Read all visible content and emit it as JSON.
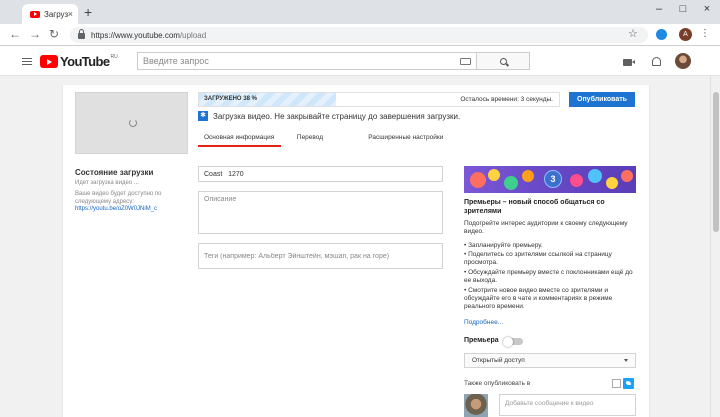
{
  "browser": {
    "tab_title": "Загрузка",
    "tab_close": "×",
    "new_tab": "+",
    "url_host": "https://www.youtube.com",
    "url_path": "/upload",
    "profile_letter": "A",
    "win_min": "–",
    "win_max": "□",
    "win_close": "×",
    "back": "←",
    "forward": "→",
    "reload": "↻",
    "star": "☆",
    "menu": "⋮"
  },
  "header": {
    "logo_text": "YouTube",
    "logo_region": "RU",
    "search_placeholder": "Введите запрос"
  },
  "upload": {
    "status_title": "Состояние загрузки",
    "status_sub": "Идет загрузка видео ...",
    "status_note": "Ваше видео будет доступно по следующему адресу:",
    "status_link": "https://youtu.be/oZ0W0JNiM_c",
    "progress_label": "ЗАГРУЖЕНО 38 %",
    "progress_fraction": 0.38,
    "progress_time": "Осталось времени: 3 секунды.",
    "publish_label": "Опубликовать",
    "notice_icon": "✱",
    "notice_text": "Загрузка видео. Не закрывайте страницу до завершения загрузки."
  },
  "tabs": [
    {
      "label": "Основная информация",
      "active": true
    },
    {
      "label": "Перевод",
      "active": false
    },
    {
      "label": "Расширенные настройки",
      "active": false
    }
  ],
  "form": {
    "title_value": "Coast   1270",
    "description_placeholder": "Описание",
    "tags_placeholder": "Теги (например: Альберт Эйнштейн, мэшап, рак на горе)"
  },
  "promo": {
    "badge_number": "3",
    "title": "Премьеры – новый способ общаться со зрителями",
    "body": "Подогрейте интерес аудитории к своему следующему видео.",
    "bullets": [
      "• Запланируйте премьеру.",
      "• Поделитесь со зрителями ссылкой на страницу просмотра.",
      "• Обсуждайте премьеру вместе с поклонниками ещё до ее выхода.",
      "• Смотрите новое видео вместе со зрителями и обсуждайте его в чате и комментариях в режиме реального времени."
    ],
    "more_link": "Подробнее..."
  },
  "settings": {
    "premiere_label": "Премьера",
    "privacy_value": "Открытый доступ",
    "also_publish_label": "Также опубликовать в",
    "share_placeholder": "Добавьте сообщение к видео"
  },
  "colors": {
    "accent_blue": "#1e74d0",
    "youtube_red": "#ff0000",
    "tab_active_red": "#e62117",
    "twitter_blue": "#1da1f2"
  }
}
